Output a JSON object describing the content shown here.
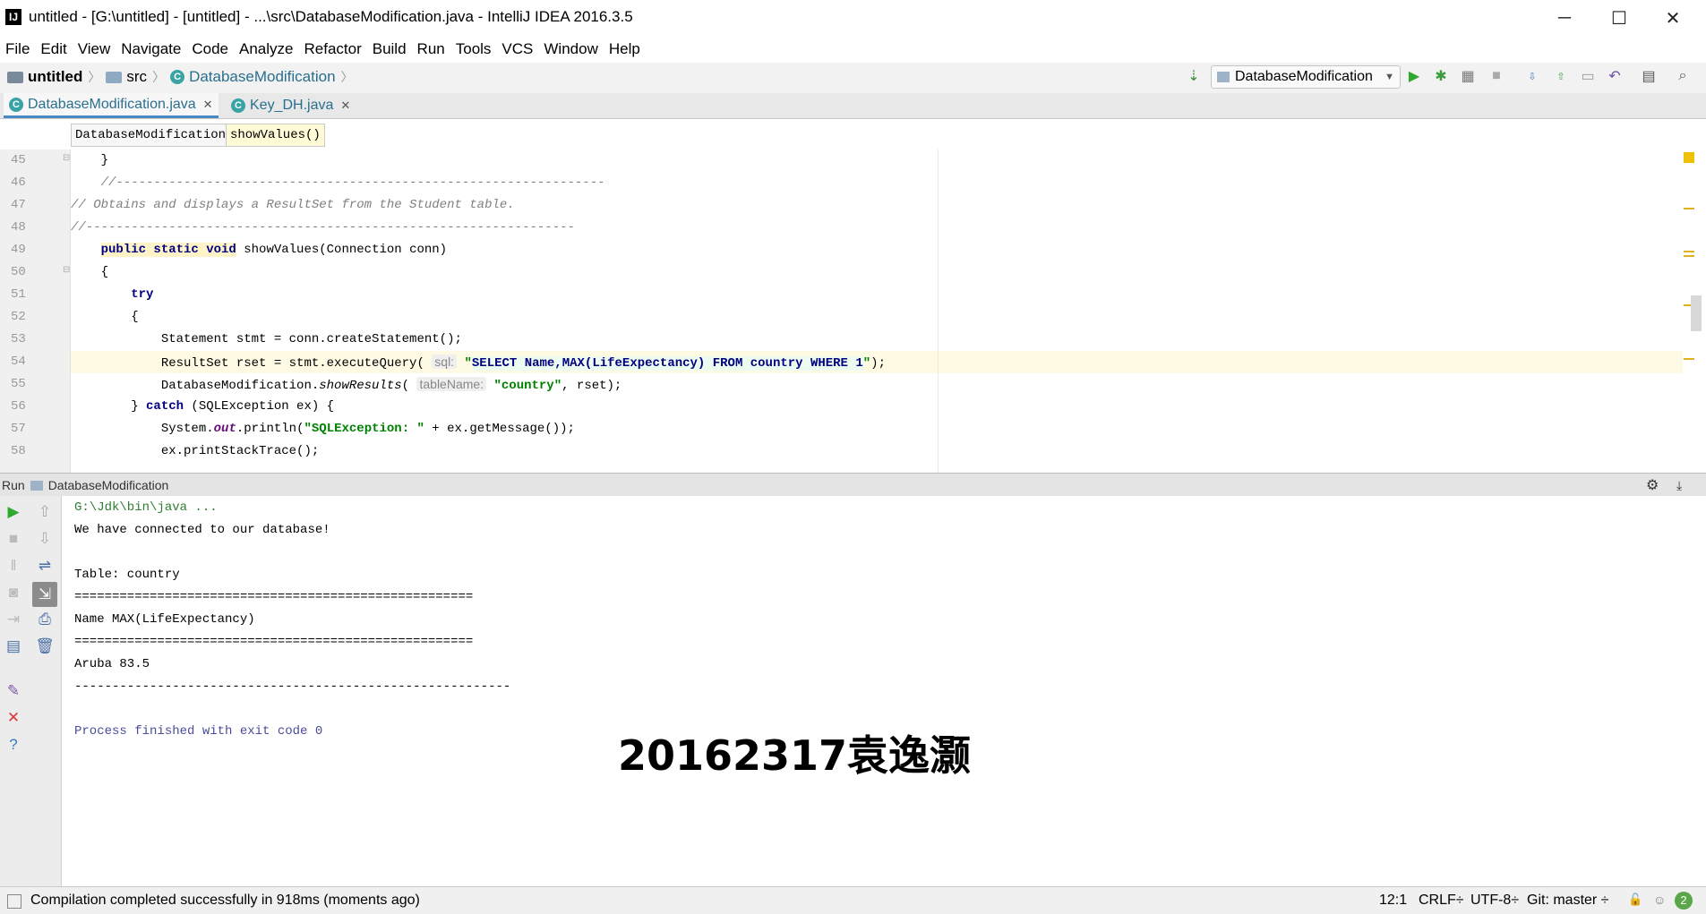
{
  "window": {
    "title": "untitled - [G:\\untitled] - [untitled] - ...\\src\\DatabaseModification.java - IntelliJ IDEA 2016.3.5",
    "logo": "IJ",
    "minimize_icon": "─",
    "maximize_icon": "☐",
    "close_icon": "✕"
  },
  "menu": [
    "File",
    "Edit",
    "View",
    "Navigate",
    "Code",
    "Analyze",
    "Refactor",
    "Build",
    "Run",
    "Tools",
    "VCS",
    "Window",
    "Help"
  ],
  "nav": {
    "project": "untitled",
    "folder": "src",
    "class": "DatabaseModification",
    "run_config": "DatabaseModification"
  },
  "tabs": [
    {
      "label": "DatabaseModification.java",
      "active": true
    },
    {
      "label": "Key_DH.java",
      "active": false
    }
  ],
  "editor_breadcrumb": {
    "class": "DatabaseModification",
    "method": "showValues()"
  },
  "code": {
    "line_numbers": [
      "45",
      "46",
      "47",
      "48",
      "49",
      "50",
      "51",
      "52",
      "53",
      "54",
      "55",
      "56",
      "57",
      "58"
    ],
    "l45": "    }",
    "l46": "    //-----------------------------------------------------------------",
    "l47": "// Obtains and displays a ResultSet from the Student table.",
    "l48": "//-----------------------------------------------------------------",
    "l49_kw": "public static void",
    "l49_rest": " showValues(Connection conn)",
    "l50": "    {",
    "l51_kw": "try",
    "l52": "        {",
    "l53": "            Statement stmt = conn.createStatement();",
    "l54_a": "            ResultSet rset = stmt.executeQuery(",
    "l54_hint": "sql:",
    "l54_q1": "\"",
    "l54_sql": "SELECT Name,MAX(LifeExpectancy) FROM country WHERE 1",
    "l54_q2": "\"",
    "l54_end": ");",
    "l55_a": "            DatabaseModification.",
    "l55_m": "showResults",
    "l55_b": "(",
    "l55_hint": "tableName:",
    "l55_str": "\"country\"",
    "l55_end": ", rset);",
    "l56_a": "        } ",
    "l56_kw": "catch",
    "l56_b": " (SQLException ex) {",
    "l57_a": "            System.",
    "l57_out": "out",
    "l57_b": ".println(",
    "l57_str": "\"SQLException: \"",
    "l57_c": " + ex.getMessage());",
    "l58": "            ex.printStackTrace();"
  },
  "run_panel": {
    "label": "Run",
    "config": "DatabaseModification"
  },
  "console": [
    "G:\\Jdk\\bin\\java ...",
    "We have connected to our database!",
    "",
    "Table: country",
    "=====================================================",
    "Name MAX(LifeExpectancy)",
    "=====================================================",
    "Aruba 83.5",
    "----------------------------------------------------------",
    "",
    "Process finished with exit code 0"
  ],
  "watermark": "20162317袁逸灏",
  "status": {
    "message": "Compilation completed successfully in 918ms (moments ago)",
    "position": "12:1",
    "line_sep": "CRLF÷",
    "encoding": "UTF-8÷",
    "vcs": "Git: master ÷",
    "badge": "2"
  }
}
